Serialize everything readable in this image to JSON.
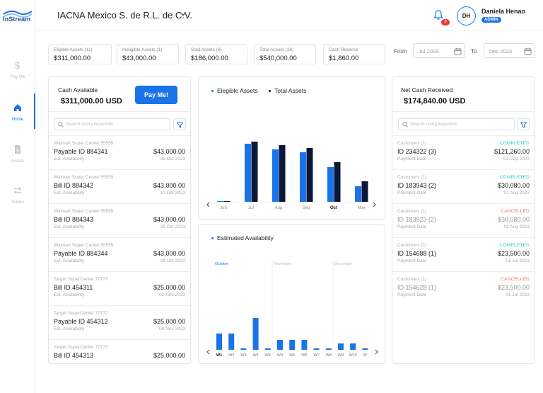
{
  "app": {
    "logo_text": "InStream"
  },
  "sidebar": {
    "items": [
      {
        "label": "Pay Me",
        "icon": "dollar-icon"
      },
      {
        "label": "Home",
        "icon": "home-icon"
      },
      {
        "label": "Assets",
        "icon": "document-icon"
      },
      {
        "label": "Trades",
        "icon": "swap-icon"
      }
    ]
  },
  "header": {
    "company": "IACNA Mexico S. de R.L. de C.V.",
    "notification_count": "8",
    "user_initials": "DH",
    "user_name": "Daniela Henao",
    "user_role": "ADMIN"
  },
  "stats": [
    {
      "label": "Eligible Assets (11)",
      "value": "$311,000.00"
    },
    {
      "label": "Ineligible Assets (1)",
      "value": "$43,000.00"
    },
    {
      "label": "Sold Assets (6)",
      "value": "$186,000.00"
    },
    {
      "label": "Total Assets (18)",
      "value": "$540,000.00"
    },
    {
      "label": "Cash Reserve",
      "value": "$1,860.00"
    }
  ],
  "date_filter": {
    "from_label": "From",
    "from_value": "Jul 2023",
    "to_label": "To",
    "to_value": "Dec 2023"
  },
  "cash_available": {
    "title": "Cash Available",
    "amount": "$311,000.00 USD",
    "button": "Pay Me!",
    "search_placeholder": "Search using keywords",
    "rows": [
      {
        "customer": "Walmart Super Center 55555",
        "id": "Payable ID 884341",
        "amount": "$43,000.00",
        "foot": "Est. Availability",
        "date": "05 Oct 2023"
      },
      {
        "customer": "Walmart Super Center 55555",
        "id": "Bill ID 884342",
        "amount": "$43,000.00",
        "foot": "Est. Availability",
        "date": "10 Oct 2023"
      },
      {
        "customer": "Walmart Super Center 55555",
        "id": "Bill ID 884343",
        "amount": "$43,000.00",
        "foot": "Est. Availability",
        "date": "25 Oct 2023"
      },
      {
        "customer": "Walmart Super Center 55555",
        "id": "Payable ID 884344",
        "amount": "$43,000.00",
        "foot": "Est. Availability",
        "date": "28 Oct 2023"
      },
      {
        "customer": "Target SuperCenter 77777",
        "id": "Bill ID 454311",
        "amount": "$25,000.00",
        "foot": "Est. Availability",
        "date": "02 Nov 2023"
      },
      {
        "customer": "Target SuperCenter 77777",
        "id": "Payable ID 454312",
        "amount": "$25,000.00",
        "foot": "Est. Availability",
        "date": "08 Nov 2023"
      },
      {
        "customer": "Target SuperCenter 77777",
        "id": "Bill ID 454313",
        "amount": "$25,000.00",
        "foot": "",
        "date": ""
      }
    ]
  },
  "net_cash": {
    "title": "Net Cash Received",
    "amount": "$174,840.00 USD",
    "search_placeholder": "Search using keywords",
    "rows": [
      {
        "customer": "Customers (1)",
        "id": "ID 234322 (3)",
        "amount": "$121,260.00",
        "foot": "Payment Date",
        "date": "01 Sep 2023",
        "status": "COMPLETED",
        "cancelled": false
      },
      {
        "customer": "Customers (1)",
        "id": "ID 183943 (2)",
        "amount": "$30,080.00",
        "foot": "Payment Date",
        "date": "01 Aug 2023",
        "status": "COMPLETED",
        "cancelled": false
      },
      {
        "customer": "Customers (1)",
        "id": "ID 183923 (2)",
        "amount": "$30,080.00",
        "foot": "Payment Date",
        "date": "01 Aug 2023",
        "status": "CANCELLED",
        "cancelled": true
      },
      {
        "customer": "Customers (1)",
        "id": "ID 154688 (1)",
        "amount": "$23,500.00",
        "foot": "Payment Date",
        "date": "01 Jul 2023",
        "status": "COMPLETED",
        "cancelled": false
      },
      {
        "customer": "Customers (1)",
        "id": "ID 154628 (1)",
        "amount": "$23,500.00",
        "foot": "Payment Date",
        "date": "01 Jul 2023",
        "status": "CANCELLED",
        "cancelled": true
      }
    ]
  },
  "colors": {
    "accent": "#1a73e8",
    "dark_bar": "#0b1736",
    "completed": "#26c6c6",
    "cancelled": "#ef6b6b"
  },
  "chart_data": [
    {
      "type": "bar",
      "categories": [
        "Jun",
        "Jul",
        "Aug",
        "Sep",
        "Oct",
        "Nov"
      ],
      "active_category": "Oct",
      "series": [
        {
          "name": "Elegible Assets",
          "values": [
            1,
            82,
            74,
            70,
            49,
            22
          ]
        },
        {
          "name": "Total Assets",
          "values": [
            1,
            85,
            80,
            76,
            56,
            29
          ]
        }
      ],
      "ylim": [
        0,
        100
      ],
      "legend_position": "top-left"
    },
    {
      "type": "bar",
      "title": "Estimated Availability",
      "months": [
        "October",
        "November",
        "December"
      ],
      "categories": [
        "W1",
        "W2",
        "W3",
        "W4",
        "W5",
        "W4",
        "W5",
        "W6",
        "W7",
        "W8",
        "W9",
        "W10",
        "W"
      ],
      "active_category": "W1",
      "values": [
        23,
        23,
        2,
        45,
        2,
        14,
        14,
        14,
        2,
        2,
        9,
        9,
        2
      ],
      "ylim": [
        0,
        100
      ]
    }
  ]
}
